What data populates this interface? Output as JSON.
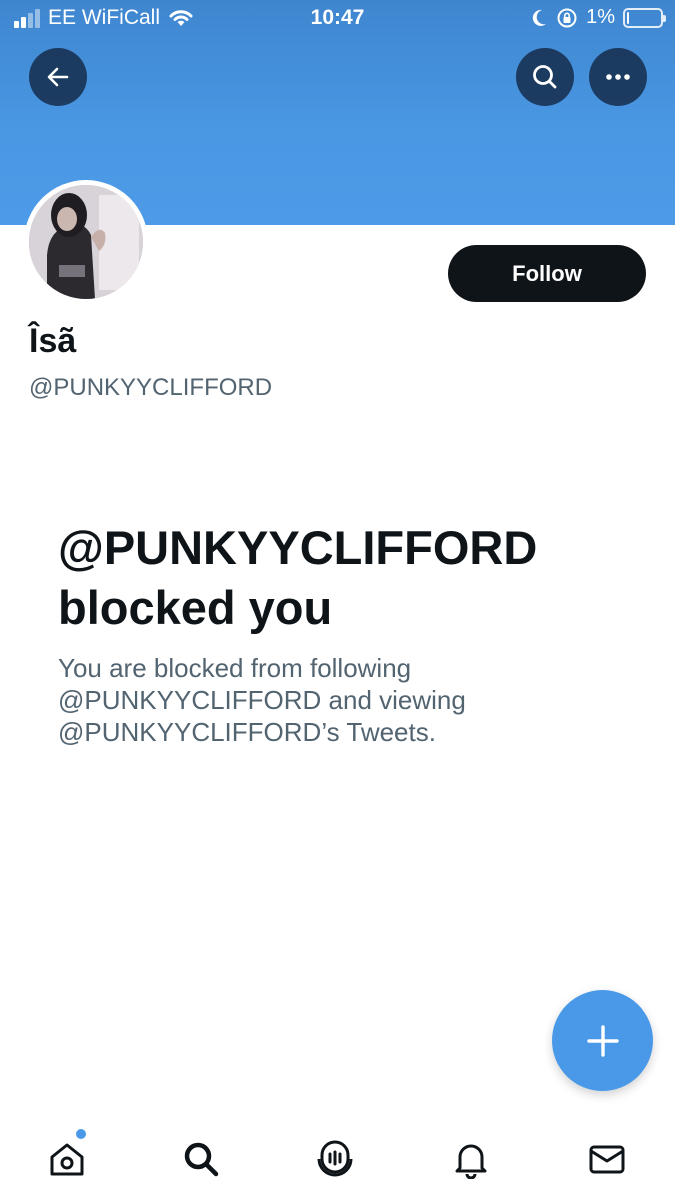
{
  "status_bar": {
    "carrier": "EE WiFiCall",
    "time": "10:47",
    "battery_percent": "1%",
    "battery_level": 0.01,
    "icons": [
      "signal-icon",
      "wifi-icon",
      "moon-icon",
      "orientation-lock-icon",
      "battery-icon"
    ]
  },
  "header": {
    "back_icon": "back-arrow-icon",
    "search_icon": "search-icon",
    "more_icon": "more-icon"
  },
  "colors": {
    "banner": "#4a98e4",
    "accent": "#4a99e9",
    "follow_button": "#0f1419",
    "secondary_text": "#536471"
  },
  "profile": {
    "display_name": "Îsã",
    "handle": "@PUNKYYCLIFFORD",
    "follow_label": "Follow"
  },
  "blocked": {
    "title_line1": "@PUNKYYCLIFFORD",
    "title_line2": "blocked you",
    "description_line1": "You are blocked from following",
    "description_line2": "@PUNKYYCLIFFORD and viewing",
    "description_line3": "@PUNKYYCLIFFORD’s Tweets."
  },
  "fab": {
    "icon": "plus-icon"
  },
  "tab_bar": {
    "items": [
      {
        "name": "home",
        "icon": "home-icon",
        "has_notification_dot": true
      },
      {
        "name": "search",
        "icon": "search-icon"
      },
      {
        "name": "spaces",
        "icon": "spaces-icon"
      },
      {
        "name": "notifications",
        "icon": "bell-icon"
      },
      {
        "name": "messages",
        "icon": "mail-icon"
      }
    ]
  }
}
